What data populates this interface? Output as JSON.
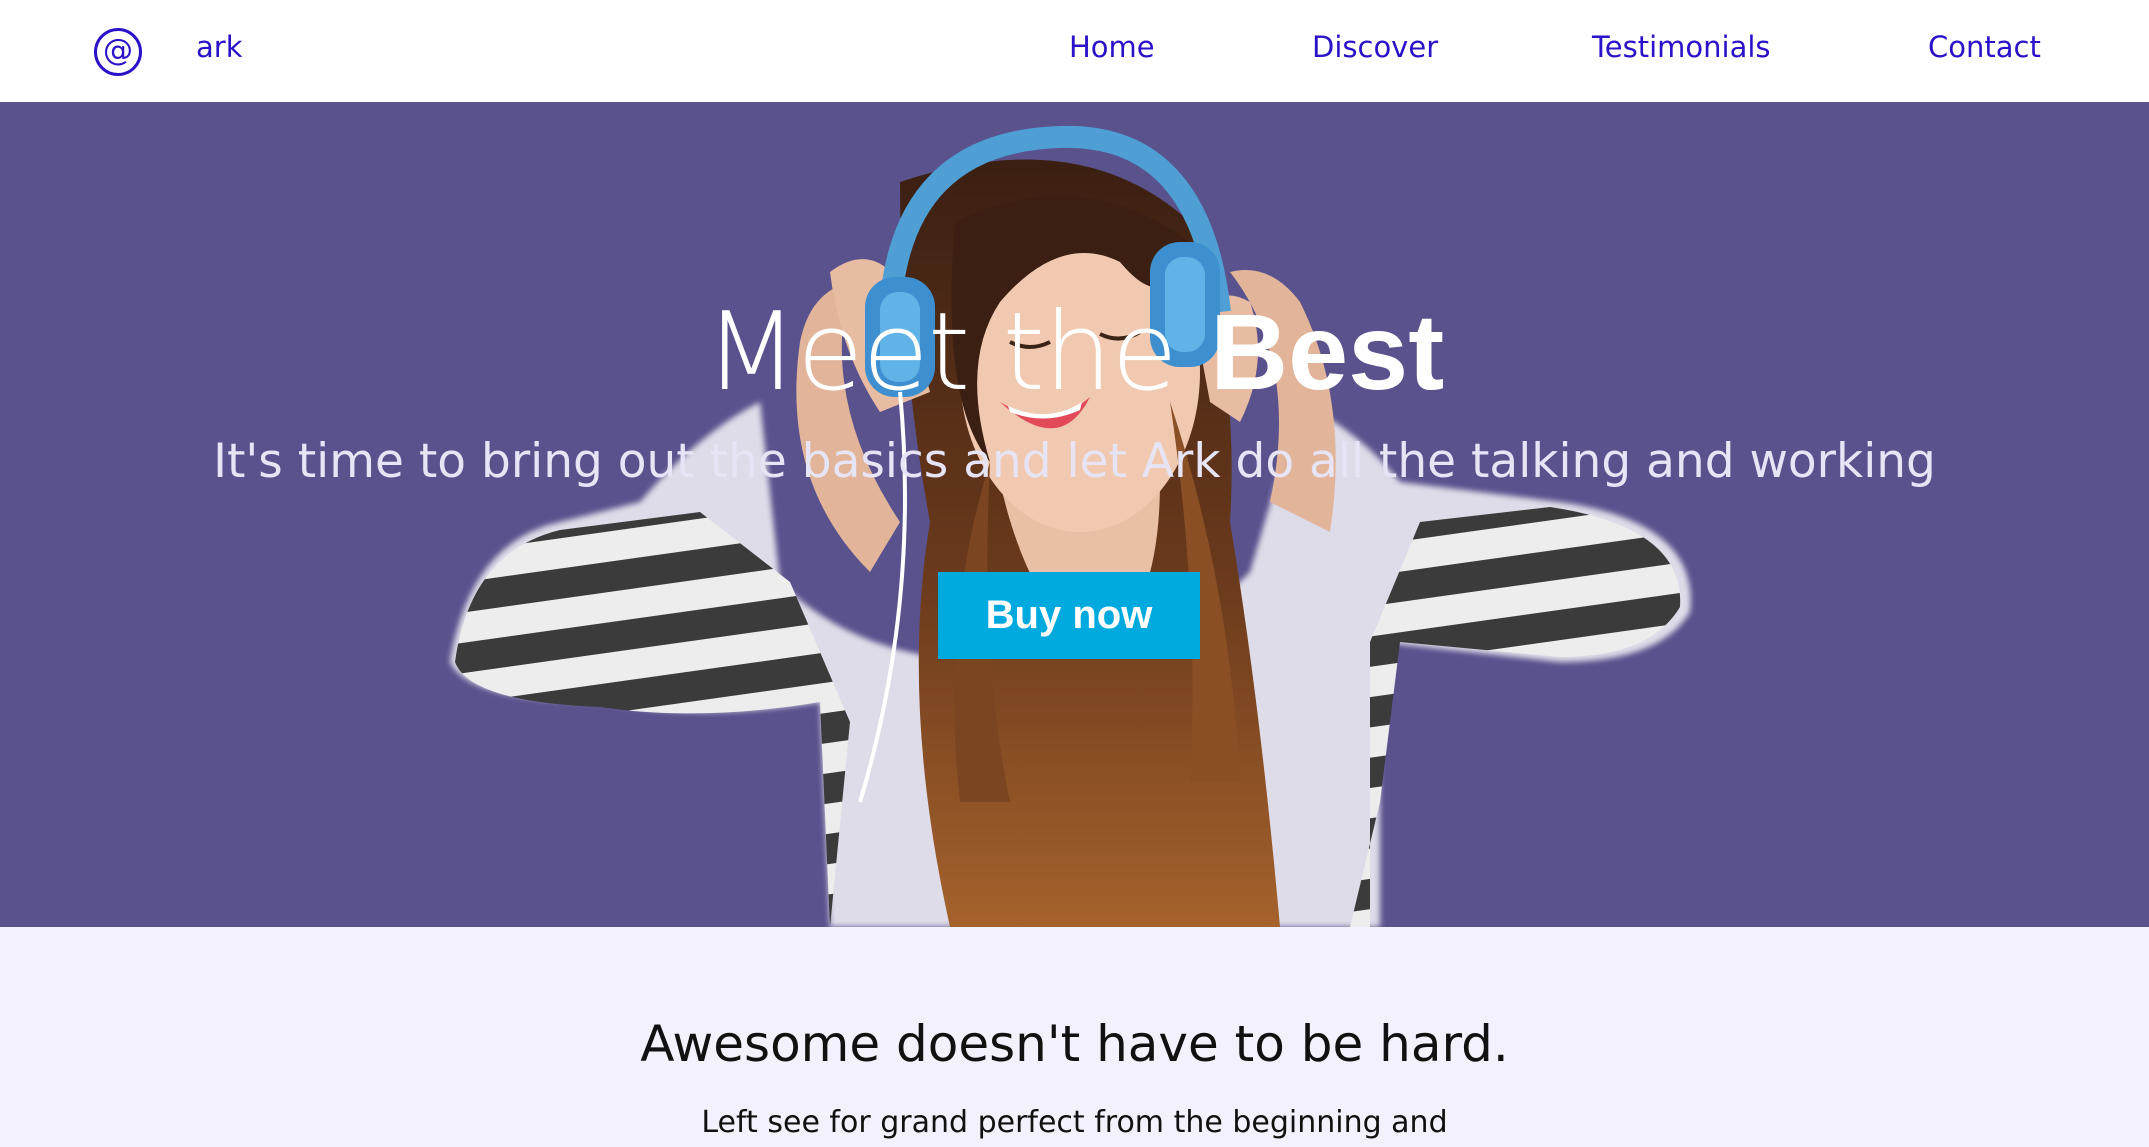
{
  "header": {
    "logo_glyph": "@",
    "brand": "ark",
    "nav": {
      "home": "Home",
      "discover": "Discover",
      "testimonials": "Testimonials",
      "contact": "Contact"
    }
  },
  "hero": {
    "title_light": "Meet the ",
    "title_bold": "Best",
    "subtitle": "It's time to bring out the basics and let Ark do all the talking and working",
    "cta_label": "Buy now"
  },
  "feature": {
    "heading": "Awesome doesn't have to be hard.",
    "text": "Left see for grand perfect from the beginning and"
  },
  "colors": {
    "accent": "#2a12c9",
    "hero_bg": "#5a528d",
    "cta": "#00aadf",
    "section_bg": "#f3f2fc"
  },
  "icons": {
    "logo": "at-sign-icon"
  }
}
